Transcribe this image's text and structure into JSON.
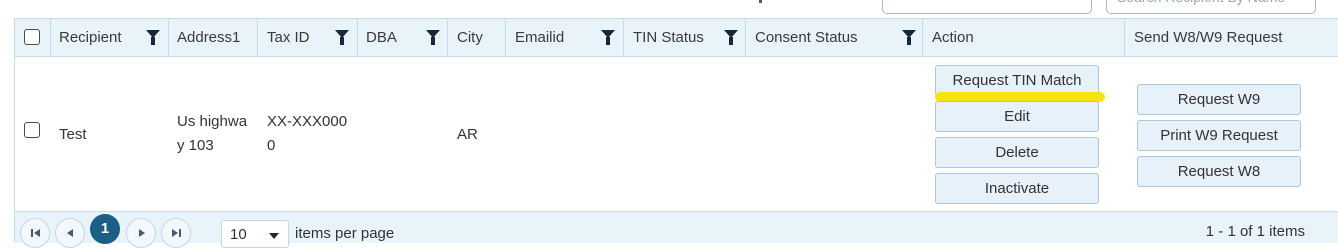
{
  "top": {
    "search_placeholder": "Search Recipient By Name"
  },
  "columns": {
    "recipient": "Recipient",
    "address1": "Address1",
    "tax_id": "Tax ID",
    "dba": "DBA",
    "city": "City",
    "emailid": "Emailid",
    "tin_status": "TIN Status",
    "consent_status": "Consent Status",
    "action": "Action",
    "send_request": "Send W8/W9 Request"
  },
  "rows": [
    {
      "recipient": "Test",
      "address_line1": "Us highwa",
      "address_line2": "y 103",
      "tax_id_line1": "XX-XXX000",
      "tax_id_line2": "0",
      "dba": "",
      "city": "AR",
      "emailid": "",
      "tin_status": "",
      "consent_status": "",
      "actions": {
        "request_tin_match": "Request TIN Match",
        "edit": "Edit",
        "delete": "Delete",
        "inactivate": "Inactivate"
      },
      "send": {
        "request_w9": "Request W9",
        "print_w9": "Print W9 Request",
        "request_w8": "Request W8"
      }
    }
  ],
  "pager": {
    "current_page": "1",
    "page_size": "10",
    "items_per_page_label": "items per page",
    "summary": "1 - 1 of 1 items"
  },
  "colors": {
    "header_bg": "#e9f3fa",
    "border": "#c5dcec",
    "button_bg": "#e7f1f9",
    "highlight": "#f5e50f",
    "active_page": "#1c5f86"
  }
}
